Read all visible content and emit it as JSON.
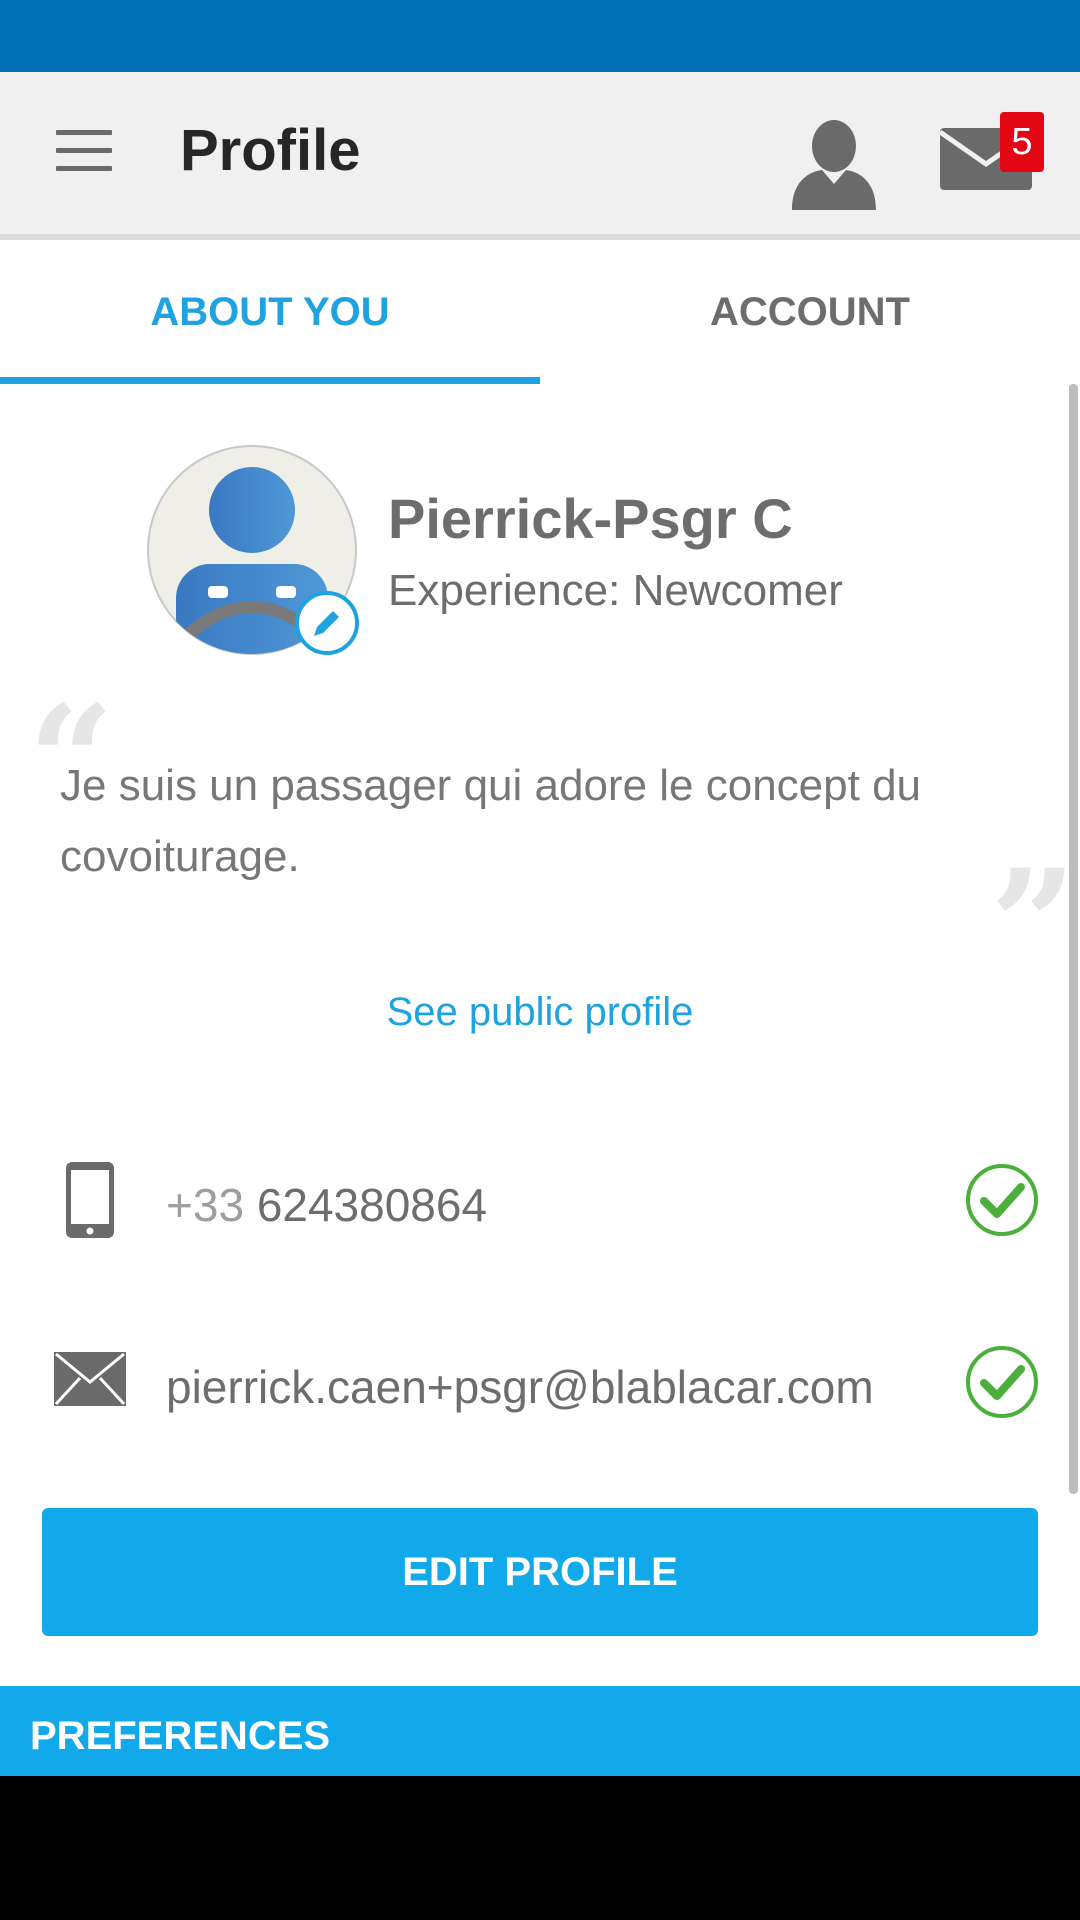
{
  "app_bar": {
    "title": "Profile",
    "messages_badge": "5"
  },
  "tabs": [
    {
      "label": "ABOUT YOU",
      "active": true
    },
    {
      "label": "ACCOUNT",
      "active": false
    }
  ],
  "profile": {
    "name": "Pierrick-Psgr C",
    "experience": "Experience: Newcomer",
    "bio": "Je suis un passager qui adore le concept du covoiturage.",
    "public_profile_link": "See public profile"
  },
  "contact": {
    "phone_prefix": "+33",
    "phone_number": "624380864",
    "phone_verified": true,
    "email": "pierrick.caen+psgr@blablacar.com",
    "email_verified": true
  },
  "actions": {
    "edit_profile": "EDIT PROFILE"
  },
  "preferences": {
    "title": "PREFERENCES"
  },
  "colors": {
    "status_bar": "#006eb3",
    "accent": "#1fa3e0",
    "button": "#12a9ea",
    "badge": "#e30613",
    "verified": "#4caf3b"
  },
  "icons": [
    "menu-icon",
    "user-icon",
    "mail-icon",
    "edit-pencil-icon",
    "phone-icon",
    "envelope-icon",
    "check-circle-icon"
  ]
}
